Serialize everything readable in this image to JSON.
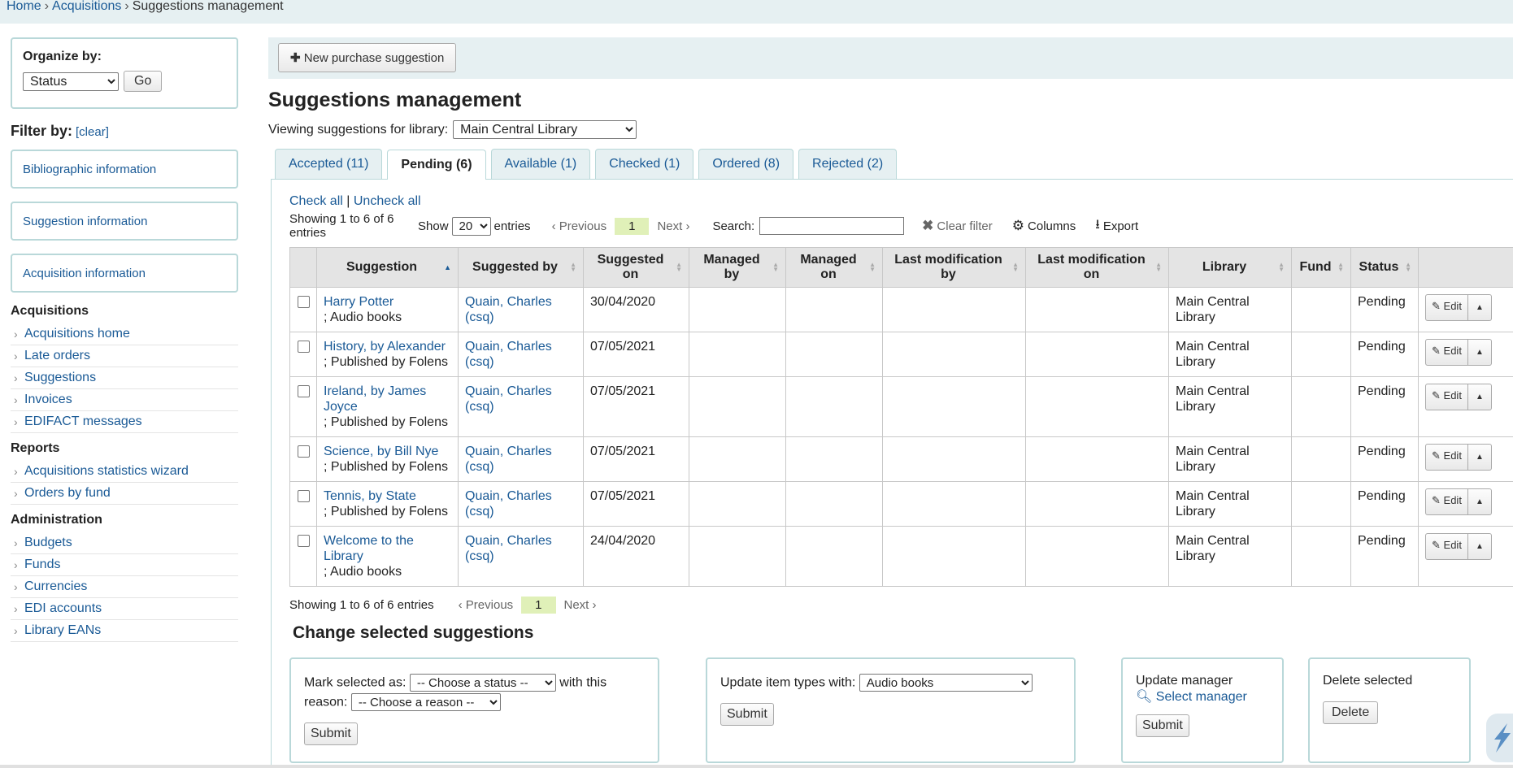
{
  "breadcrumb": {
    "home": "Home",
    "acquisitions": "Acquisitions",
    "current": "Suggestions management",
    "sep": "›"
  },
  "sidebar": {
    "organize_label": "Organize by:",
    "organize_value": "Status",
    "go_label": "Go",
    "filter_title": "Filter by:",
    "clear_label": "[clear]",
    "filters": [
      "Bibliographic information",
      "Suggestion information",
      "Acquisition information"
    ],
    "sections": [
      {
        "title": "Acquisitions",
        "items": [
          "Acquisitions home",
          "Late orders",
          "Suggestions",
          "Invoices",
          "EDIFACT messages"
        ]
      },
      {
        "title": "Reports",
        "items": [
          "Acquisitions statistics wizard",
          "Orders by fund"
        ]
      },
      {
        "title": "Administration",
        "items": [
          "Budgets",
          "Funds",
          "Currencies",
          "EDI accounts",
          "Library EANs"
        ]
      }
    ]
  },
  "toolbar": {
    "new_label": "New purchase suggestion"
  },
  "page_title": "Suggestions management",
  "library": {
    "label": "Viewing suggestions for library:",
    "value": "Main Central Library"
  },
  "tabs": [
    "Accepted (11)",
    "Pending (6)",
    "Available (1)",
    "Checked (1)",
    "Ordered (8)",
    "Rejected (2)"
  ],
  "check_all": "Check all",
  "check_sep": "|",
  "uncheck_all": "Uncheck all",
  "showing": "Showing 1 to 6 of 6 entries",
  "show_label": "Show",
  "show_value": "20",
  "entries_label": "entries",
  "pager": {
    "previous": "Previous",
    "page": "1",
    "next": "Next"
  },
  "search_label": "Search:",
  "clear_filter": "Clear filter",
  "columns_label": "Columns",
  "export_label": "Export",
  "table": {
    "headers": [
      "Suggestion",
      "Suggested by",
      "Suggested on",
      "Managed by",
      "Managed on",
      "Last modification by",
      "Last modification on",
      "Library",
      "Fund",
      "Status"
    ],
    "rows": [
      {
        "title": "Harry Potter",
        "detail": "; Audio books",
        "by": "Quain, Charles (csq)",
        "on": "30/04/2020",
        "library": "Main Central Library",
        "status": "Pending"
      },
      {
        "title": "History, by Alexander",
        "detail": "; Published by Folens",
        "by": "Quain, Charles (csq)",
        "on": "07/05/2021",
        "library": "Main Central Library",
        "status": "Pending"
      },
      {
        "title": "Ireland, by James Joyce",
        "detail": "; Published by Folens",
        "by": "Quain, Charles (csq)",
        "on": "07/05/2021",
        "library": "Main Central Library",
        "status": "Pending"
      },
      {
        "title": "Science, by Bill Nye",
        "detail": "; Published by Folens",
        "by": "Quain, Charles (csq)",
        "on": "07/05/2021",
        "library": "Main Central Library",
        "status": "Pending"
      },
      {
        "title": "Tennis, by State",
        "detail": "; Published by Folens",
        "by": "Quain, Charles (csq)",
        "on": "07/05/2021",
        "library": "Main Central Library",
        "status": "Pending"
      },
      {
        "title": "Welcome to the Library",
        "detail": "; Audio books",
        "by": "Quain, Charles (csq)",
        "on": "24/04/2020",
        "library": "Main Central Library",
        "status": "Pending"
      }
    ],
    "edit_label": "Edit"
  },
  "change_title": "Change selected suggestions",
  "mark": {
    "label": "Mark selected as:",
    "status_placeholder": "-- Choose a status --",
    "with_reason": "with this",
    "reason_label": "reason:",
    "reason_placeholder": "-- Choose a reason --",
    "submit": "Submit"
  },
  "itemtype": {
    "label": "Update item types with:",
    "value": "Audio books",
    "submit": "Submit"
  },
  "manager": {
    "label": "Update manager",
    "select": "Select manager",
    "submit": "Submit"
  },
  "delete": {
    "label": "Delete selected",
    "button": "Delete"
  }
}
